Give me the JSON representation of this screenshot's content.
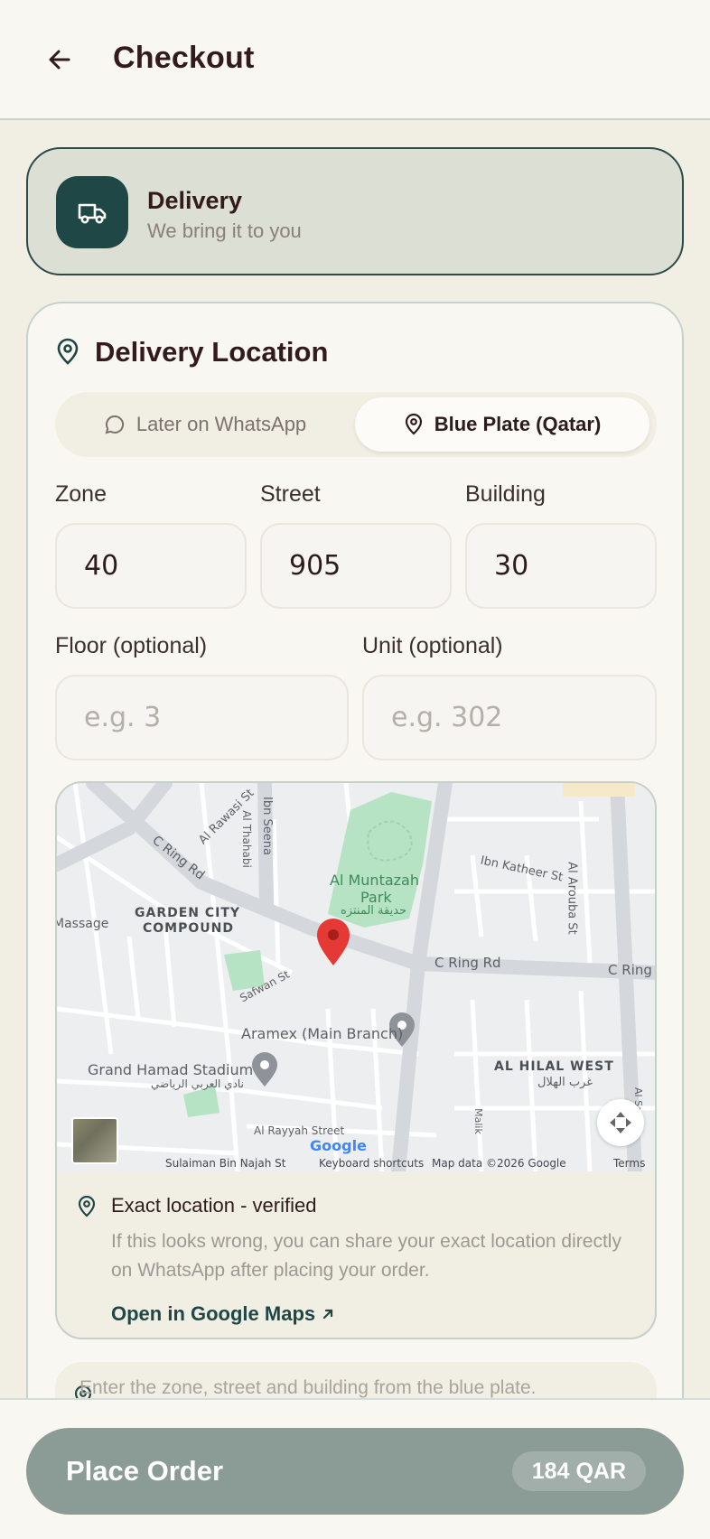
{
  "header": {
    "title": "Checkout",
    "back_icon": "arrow-left-icon"
  },
  "delivery": {
    "title": "Delivery",
    "subtitle": "We bring it to you",
    "icon": "truck-icon"
  },
  "location": {
    "title": "Delivery Location",
    "options": [
      {
        "label": "Later on WhatsApp",
        "icon": "chat-bubble-icon",
        "selected": false
      },
      {
        "label": "Blue Plate (Qatar)",
        "icon": "map-pin-icon",
        "selected": true
      }
    ],
    "fields": {
      "zone": {
        "label": "Zone",
        "value": "40"
      },
      "street": {
        "label": "Street",
        "value": "905"
      },
      "building": {
        "label": "Building",
        "value": "30"
      },
      "floor": {
        "label": "Floor (optional)",
        "placeholder": "e.g. 3"
      },
      "unit": {
        "label": "Unit (optional)",
        "placeholder": "e.g. 302"
      }
    },
    "map": {
      "labels": {
        "al_rawasi": "Al Rawasi St",
        "ibn_seena": "Ibn Seena",
        "al_thahabi": "Al Thahabi",
        "c_ring_rd_left": "C Ring Rd",
        "al_muntazah": "Al Muntazah",
        "park": "Park",
        "park_ar": "حديقة المنتزه",
        "ibn_katheer": "Ibn Katheer St",
        "al_arouba": "Al Arouba St",
        "massage": "Massage",
        "garden_city": "GARDEN CITY",
        "compound": "COMPOUND",
        "c_ring_rd_mid": "C Ring Rd",
        "c_ring_rd_right": "C Ring",
        "safwan": "Safwan St",
        "aramex": "Aramex (Main Branch)",
        "grand_hamad": "Grand Hamad Stadium",
        "grand_hamad_ar": "نادي العربي الرياضي",
        "al_hilal_west": "AL HILAL WEST",
        "al_hilal_ar": "غرب الهلال",
        "al_rayyah": "Al Rayyah Street",
        "malik": "Malik",
        "al_sarf": "Al Sarf St",
        "sulaiman": "Sulaiman Bin Najah St",
        "google": "Google",
        "keyboard": "Keyboard shortcuts",
        "map_data": "Map data ©2026 Google",
        "terms": "Terms"
      }
    },
    "verified": {
      "title": "Exact location - verified",
      "desc": "If this looks wrong, you can share your exact location directly on WhatsApp after placing your order.",
      "link": "Open in Google Maps"
    },
    "hint": "Enter the zone, street and building from the blue plate."
  },
  "footer": {
    "button_label": "Place Order",
    "price": "184 QAR"
  },
  "colors": {
    "accent": "#1f4745",
    "button": "#8b9c97",
    "pin": "#e53935"
  }
}
